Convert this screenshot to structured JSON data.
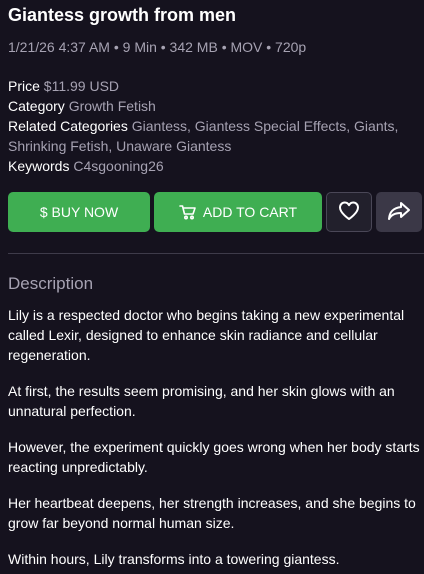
{
  "product": {
    "title": "Giantess growth from men",
    "meta": "1/21/26 4:37 AM • 9 Min • 342 MB • MOV • 720p"
  },
  "details": {
    "price_label": "Price",
    "price_value": "$11.99 USD",
    "category_label": "Category",
    "category_value": "Growth Fetish",
    "related_label": "Related Categories",
    "related_value": "Giantess, Giantess Special Effects, Giants, Shrinking Fetish, Unaware Giantess",
    "keywords_label": "Keywords",
    "keywords_value": "C4sgooning26"
  },
  "actions": {
    "buy_label": "$ BUY NOW",
    "cart_label": "ADD TO CART",
    "cart_icon": "cart-icon",
    "favorite_icon": "heart-icon",
    "share_icon": "share-icon",
    "accent_color": "#3fae52"
  },
  "description": {
    "heading": "Description",
    "paragraphs": [
      "Lily is a respected doctor who begins taking a new experimental called Lexir, designed to enhance skin radiance and cellular regeneration.",
      "At first, the results seem promising, and her skin glows with an unnatural perfection.",
      "However, the experiment quickly goes wrong when her body starts reacting unpredictably.",
      "Her heartbeat deepens, her strength increases, and she begins to grow far beyond normal human size.",
      "Within hours, Lily transforms into a towering giantess."
    ]
  }
}
